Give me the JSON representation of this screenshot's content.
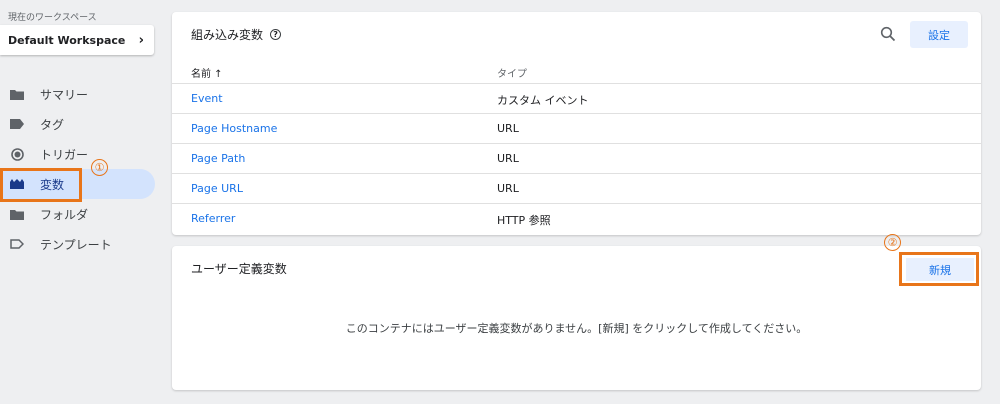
{
  "sidebar": {
    "workspace_label": "現在のワークスペース",
    "workspace_name": "Default Workspace",
    "items": [
      {
        "label": "サマリー",
        "icon": "folder-icon"
      },
      {
        "label": "タグ",
        "icon": "tag-icon"
      },
      {
        "label": "トリガー",
        "icon": "trigger-icon"
      },
      {
        "label": "変数",
        "icon": "variables-icon",
        "active": true
      },
      {
        "label": "フォルダ",
        "icon": "folder-icon"
      },
      {
        "label": "テンプレート",
        "icon": "template-icon"
      }
    ]
  },
  "annotations": {
    "one": "①",
    "two": "②"
  },
  "builtin": {
    "title": "組み込み変数",
    "settings_label": "設定",
    "col_name": "名前 ↑",
    "col_type": "タイプ",
    "rows": [
      {
        "name": "Event",
        "type": "カスタム イベント"
      },
      {
        "name": "Page Hostname",
        "type": "URL"
      },
      {
        "name": "Page Path",
        "type": "URL"
      },
      {
        "name": "Page URL",
        "type": "URL"
      },
      {
        "name": "Referrer",
        "type": "HTTP 参照"
      }
    ]
  },
  "user_defined": {
    "title": "ユーザー定義変数",
    "new_label": "新規",
    "empty_message": "このコンテナにはユーザー定義変数がありません。[新規] をクリックして作成してください。"
  },
  "colors": {
    "accent": "#1a73e8",
    "highlight": "#e8751a",
    "active_bg": "#d3e3fd"
  }
}
